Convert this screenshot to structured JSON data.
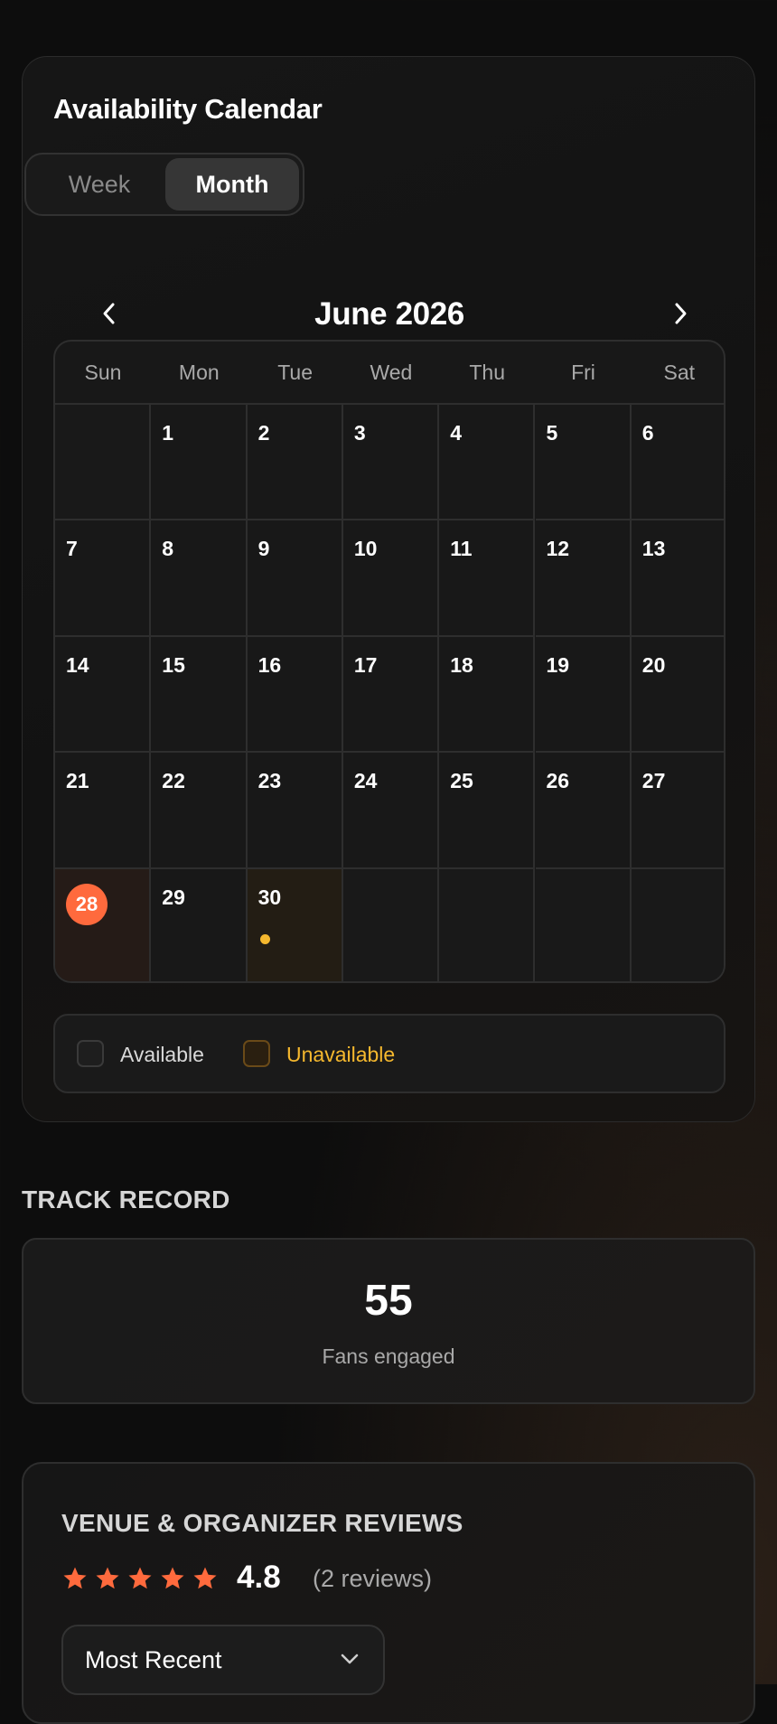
{
  "calendar": {
    "title": "Availability Calendar",
    "view_toggle": {
      "options": [
        "Week",
        "Month"
      ],
      "selected": "Month"
    },
    "month_label": "June 2026",
    "weekdays": [
      "Sun",
      "Mon",
      "Tue",
      "Wed",
      "Thu",
      "Fri",
      "Sat"
    ],
    "weeks": [
      [
        "",
        "1",
        "2",
        "3",
        "4",
        "5",
        "6"
      ],
      [
        "7",
        "8",
        "9",
        "10",
        "11",
        "12",
        "13"
      ],
      [
        "14",
        "15",
        "16",
        "17",
        "18",
        "19",
        "20"
      ],
      [
        "21",
        "22",
        "23",
        "24",
        "25",
        "26",
        "27"
      ],
      [
        "28",
        "29",
        "30",
        "",
        "",
        "",
        ""
      ]
    ],
    "today": "28",
    "unavailable_days": [
      "30"
    ],
    "legend": {
      "available": "Available",
      "unavailable": "Unavailable"
    },
    "colors": {
      "today": "#ff6a3d",
      "unavailable": "#f5b82e"
    }
  },
  "track_record": {
    "heading": "TRACK RECORD",
    "value": "55",
    "label": "Fans engaged"
  },
  "reviews": {
    "heading": "VENUE & ORGANIZER REVIEWS",
    "stars": 5,
    "rating": "4.8",
    "count_text": "(2 reviews)",
    "sort": {
      "selected": "Most Recent"
    },
    "star_color": "#ff6a3d"
  }
}
